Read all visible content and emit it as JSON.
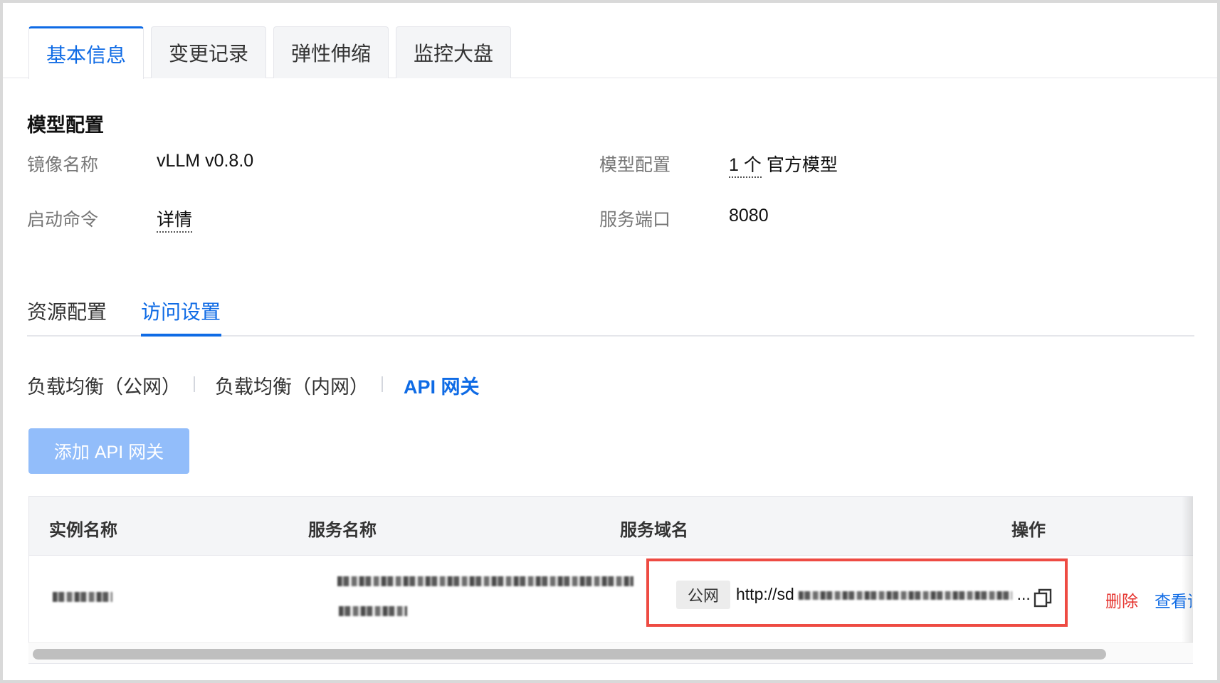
{
  "top_tabs": [
    {
      "label": "基本信息",
      "active": true
    },
    {
      "label": "变更记录",
      "active": false
    },
    {
      "label": "弹性伸缩",
      "active": false
    },
    {
      "label": "监控大盘",
      "active": false
    }
  ],
  "model_config": {
    "title": "模型配置",
    "image_name_label": "镜像名称",
    "image_name_value": "vLLM v0.8.0",
    "start_cmd_label": "启动命令",
    "start_cmd_value": "详情",
    "model_cfg_label": "模型配置",
    "model_cfg_count": "1 个",
    "model_cfg_value": "官方模型",
    "port_label": "服务端口",
    "port_value": "8080"
  },
  "sub_tabs": [
    {
      "label": "资源配置",
      "active": false
    },
    {
      "label": "访问设置",
      "active": true
    }
  ],
  "segments": [
    {
      "label": "负载均衡（公网）",
      "active": false
    },
    {
      "label": "负载均衡（内网）",
      "active": false
    },
    {
      "label": "API 网关",
      "active": true
    }
  ],
  "add_button_label": "添加 API 网关",
  "table": {
    "headers": [
      "实例名称",
      "服务名称",
      "服务域名",
      "操作"
    ],
    "row": {
      "domain_badge": "公网",
      "domain_prefix": "http://sd",
      "domain_suffix": "...",
      "actions": [
        "删除",
        "查看详情"
      ]
    }
  },
  "colors": {
    "accent": "#0f6be5",
    "danger": "#e5322d",
    "highlight_border": "#ee4b43",
    "disabled_button": "#92bdfa"
  },
  "icons": {
    "copy": "copy-icon"
  }
}
